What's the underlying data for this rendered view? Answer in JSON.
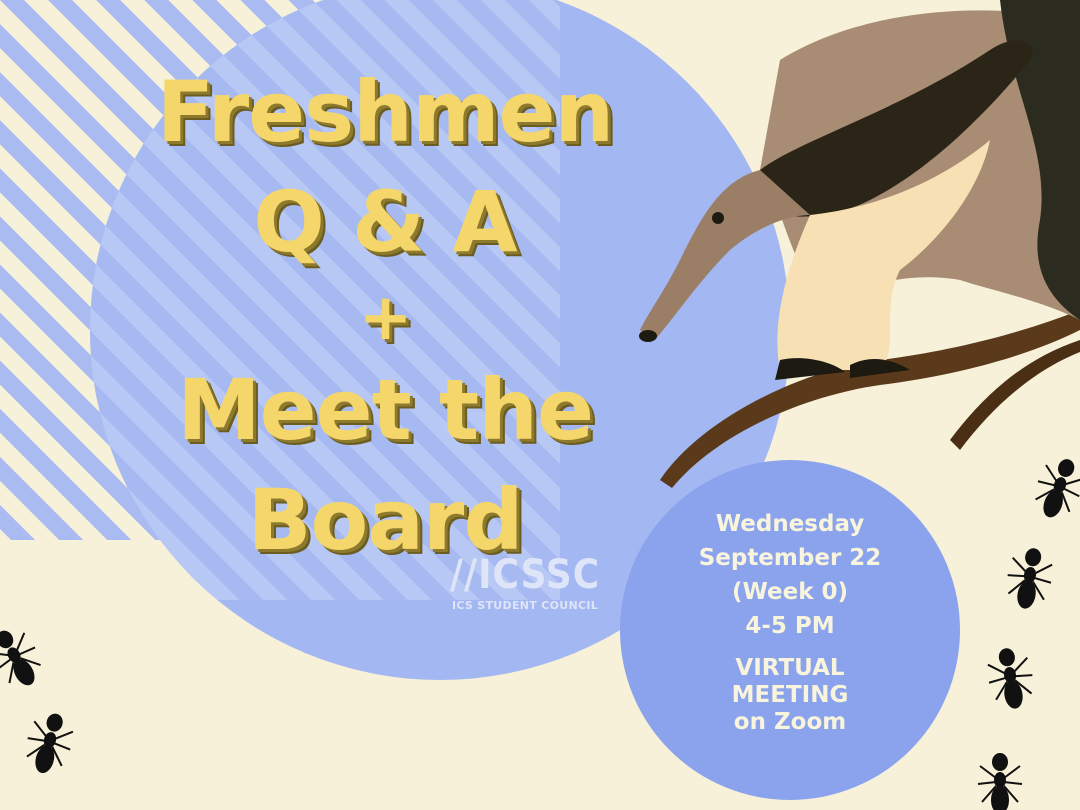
{
  "title": {
    "line1": "Freshmen",
    "line2": "Q & A",
    "line3": "+",
    "line4": "Meet the",
    "line5": "Board"
  },
  "logo": {
    "mark": "//ICSSC",
    "subtitle": "ICS STUDENT COUNCIL"
  },
  "event": {
    "day": "Wednesday",
    "date": "September 22",
    "week": "(Week 0)",
    "time": "4-5 PM",
    "location_line1": "VIRTUAL",
    "location_line2": "MEETING",
    "location_line3": "on Zoom"
  },
  "colors": {
    "background": "#f7f1da",
    "circle_blue": "#a3b7f2",
    "title_yellow": "#f5d66a",
    "info_circle": "#8aa3ec"
  }
}
